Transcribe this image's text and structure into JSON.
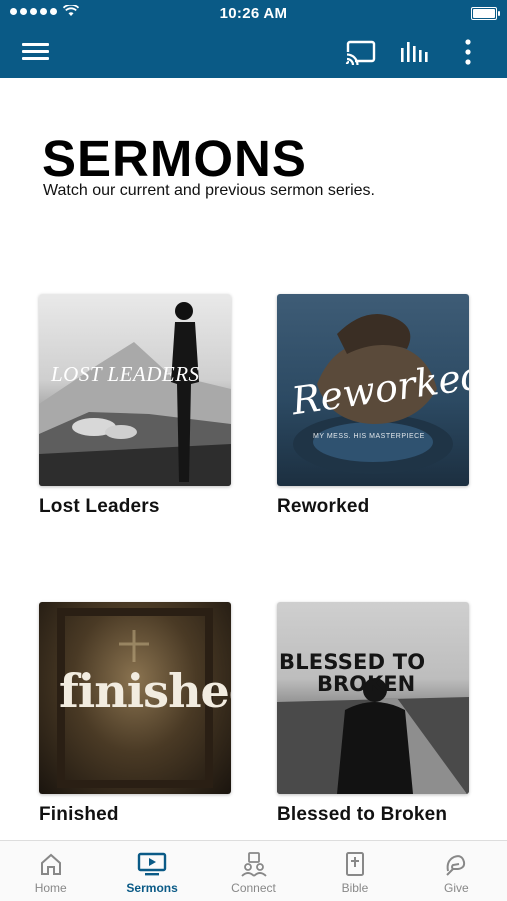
{
  "status": {
    "time": "10:26 AM"
  },
  "header": {
    "icons": [
      "menu-icon",
      "cast-icon",
      "equalizer-icon",
      "more-vertical-icon"
    ]
  },
  "page": {
    "title": "SERMONS",
    "subtitle": "Watch our current and previous sermon series."
  },
  "sermons": [
    {
      "title": "Lost Leaders",
      "art_text": "LOST LEADERS"
    },
    {
      "title": "Reworked",
      "art_text": "Reworked",
      "art_subtext": "MY MESS. HIS MASTERPIECE"
    },
    {
      "title": "Finished",
      "art_text": "finished"
    },
    {
      "title": "Blessed to Broken",
      "art_text_line1": "BLESSED TO",
      "art_text_line2": "BROKEN"
    }
  ],
  "tabs": [
    {
      "label": "Home",
      "icon": "home-icon"
    },
    {
      "label": "Sermons",
      "icon": "video-icon",
      "active": true
    },
    {
      "label": "Connect",
      "icon": "people-icon"
    },
    {
      "label": "Bible",
      "icon": "bible-icon"
    },
    {
      "label": "Give",
      "icon": "give-icon"
    }
  ],
  "colors": {
    "brand": "#0a5a86",
    "tab_inactive": "#888888"
  }
}
